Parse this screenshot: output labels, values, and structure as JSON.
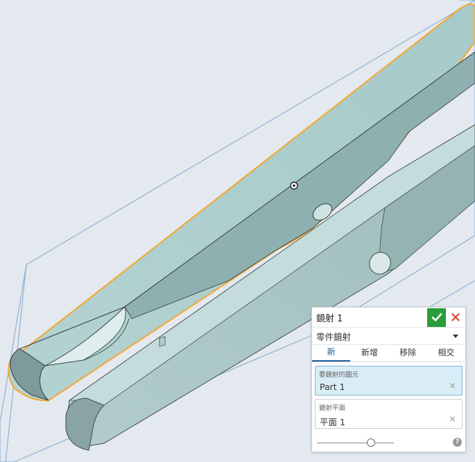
{
  "panel": {
    "title": "鏡射 1",
    "mode": "零件鏡射",
    "tabs": [
      "新",
      "新增",
      "移除",
      "相交"
    ],
    "active_tab": "新",
    "entities_field": {
      "label": "要鏡射的圖元",
      "value": "Part 1"
    },
    "plane_field": {
      "label": "鏡射平面",
      "value": "平面 1"
    },
    "slider_value": 0.7
  },
  "icons": {
    "confirm": "checkmark-icon",
    "cancel": "close-icon",
    "dropdown": "chevron-down-icon",
    "clear": "clear-x-icon",
    "help": "help-icon"
  },
  "colors": {
    "confirm_green": "#2a9d3a",
    "cancel_red": "#d9442c",
    "selection_orange": "#f2a93b",
    "active_tab_blue": "#1f5f9c",
    "active_field_bg": "#d9edf6"
  }
}
